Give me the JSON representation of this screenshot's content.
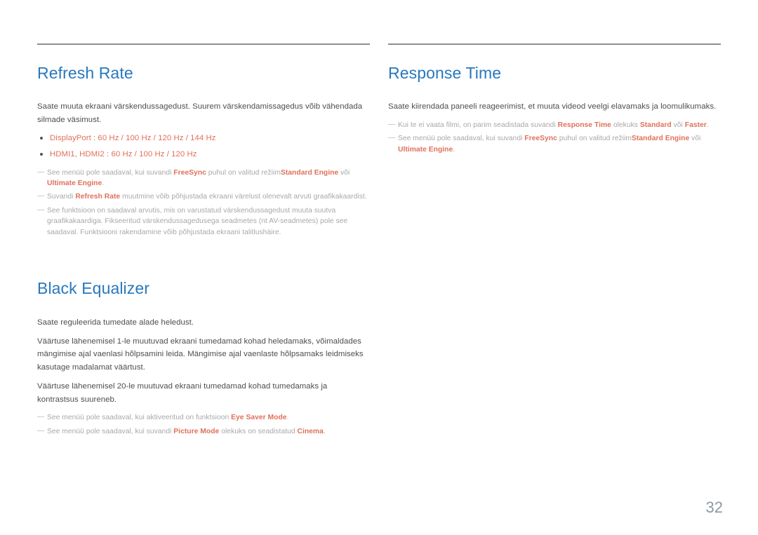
{
  "page": {
    "number": "32",
    "accent_heading_color": "#2878bd",
    "accent_highlight_color": "#e0705a",
    "body_text_color": "#4d4d4d",
    "note_text_color": "#a8a8a8",
    "rule_color": "#8e8e8e"
  },
  "left_column": {
    "sections": [
      {
        "title": "Refresh Rate",
        "intro": "Saate muuta ekraani värskendussagedust. Suurem värskendamissagedus võib vähendada silmade väsimust.",
        "bullets": [
          "DisplayPort : 60 Hz / 100 Hz / 120 Hz / 144 Hz",
          "HDMI1, HDMI2 : 60 Hz / 100 Hz / 120 Hz"
        ],
        "notes": [
          {
            "dash": "―",
            "parts": [
              {
                "text": "See menüü pole saadaval, kui suvandi ",
                "highlight": false
              },
              {
                "text": "FreeSync",
                "highlight": true
              },
              {
                "text": " puhul on valitud režiim",
                "highlight": false
              },
              {
                "text": "Standard Engine",
                "highlight": true
              },
              {
                "text": " või ",
                "highlight": false
              },
              {
                "text": "Ultimate Engine",
                "highlight": true
              },
              {
                "text": ".",
                "highlight": false
              }
            ]
          },
          {
            "dash": "―",
            "parts": [
              {
                "text": "Suvandi ",
                "highlight": false
              },
              {
                "text": "Refresh Rate",
                "highlight": true
              },
              {
                "text": " muutmine võib põhjustada ekraani värelust olenevalt arvuti graafikakaardist.",
                "highlight": false
              }
            ]
          },
          {
            "dash": "―",
            "parts": [
              {
                "text": "See funktsioon on saadaval arvutis, mis on varustatud värskendussagedust muuta suutva graafikakaardiga. Fikseeritud värskendussagedusega seadmetes (nt AV-seadmetes) pole see saadaval. Funktsiooni rakendamine võib põhjustada ekraani talitlushäire.",
                "highlight": false
              }
            ]
          }
        ]
      },
      {
        "title": "Black Equalizer",
        "paragraphs": [
          "Saate reguleerida tumedate alade heledust.",
          "Väärtuse lähenemisel 1-le muutuvad ekraani tumedamad kohad heledamaks, võimaldades mängimise ajal vaenlasi hõlpsamini leida. Mängimise ajal vaenlaste hõlpsamaks leidmiseks kasutage madalamat väärtust.",
          "Väärtuse lähenemisel 20-le muutuvad ekraani tumedamad kohad tumedamaks ja kontrastsus suureneb."
        ],
        "notes": [
          {
            "dash": "―",
            "parts": [
              {
                "text": "See menüü pole saadaval, kui aktiveeritud on funktsioon ",
                "highlight": false
              },
              {
                "text": "Eye Saver Mode",
                "highlight": true
              },
              {
                "text": ".",
                "highlight": false
              }
            ]
          },
          {
            "dash": "―",
            "parts": [
              {
                "text": "See menüü pole saadaval, kui suvandi ",
                "highlight": false
              },
              {
                "text": "Picture Mode",
                "highlight": true
              },
              {
                "text": " olekuks on seadistatud ",
                "highlight": false
              },
              {
                "text": "Cinema",
                "highlight": true
              },
              {
                "text": ".",
                "highlight": false
              }
            ]
          }
        ]
      }
    ]
  },
  "right_column": {
    "sections": [
      {
        "title": "Response Time",
        "intro": "Saate kiirendada paneeli reageerimist, et muuta videod veelgi elavamaks ja loomulikumaks.",
        "notes": [
          {
            "dash": "―",
            "parts": [
              {
                "text": "Kui te ei vaata filmi, on parim seadistada suvandi ",
                "highlight": false
              },
              {
                "text": "Response Time",
                "highlight": true
              },
              {
                "text": " olekuks ",
                "highlight": false
              },
              {
                "text": "Standard",
                "highlight": true
              },
              {
                "text": " või ",
                "highlight": false
              },
              {
                "text": "Faster",
                "highlight": true
              },
              {
                "text": ".",
                "highlight": false
              }
            ]
          },
          {
            "dash": "―",
            "parts": [
              {
                "text": "See menüü pole saadaval, kui suvandi ",
                "highlight": false
              },
              {
                "text": "FreeSync",
                "highlight": true
              },
              {
                "text": " puhul on valitud režiim",
                "highlight": false
              },
              {
                "text": "Standard Engine",
                "highlight": true
              },
              {
                "text": " või ",
                "highlight": false
              },
              {
                "text": "Ultimate Engine",
                "highlight": true
              },
              {
                "text": ".",
                "highlight": false
              }
            ]
          }
        ]
      }
    ]
  }
}
